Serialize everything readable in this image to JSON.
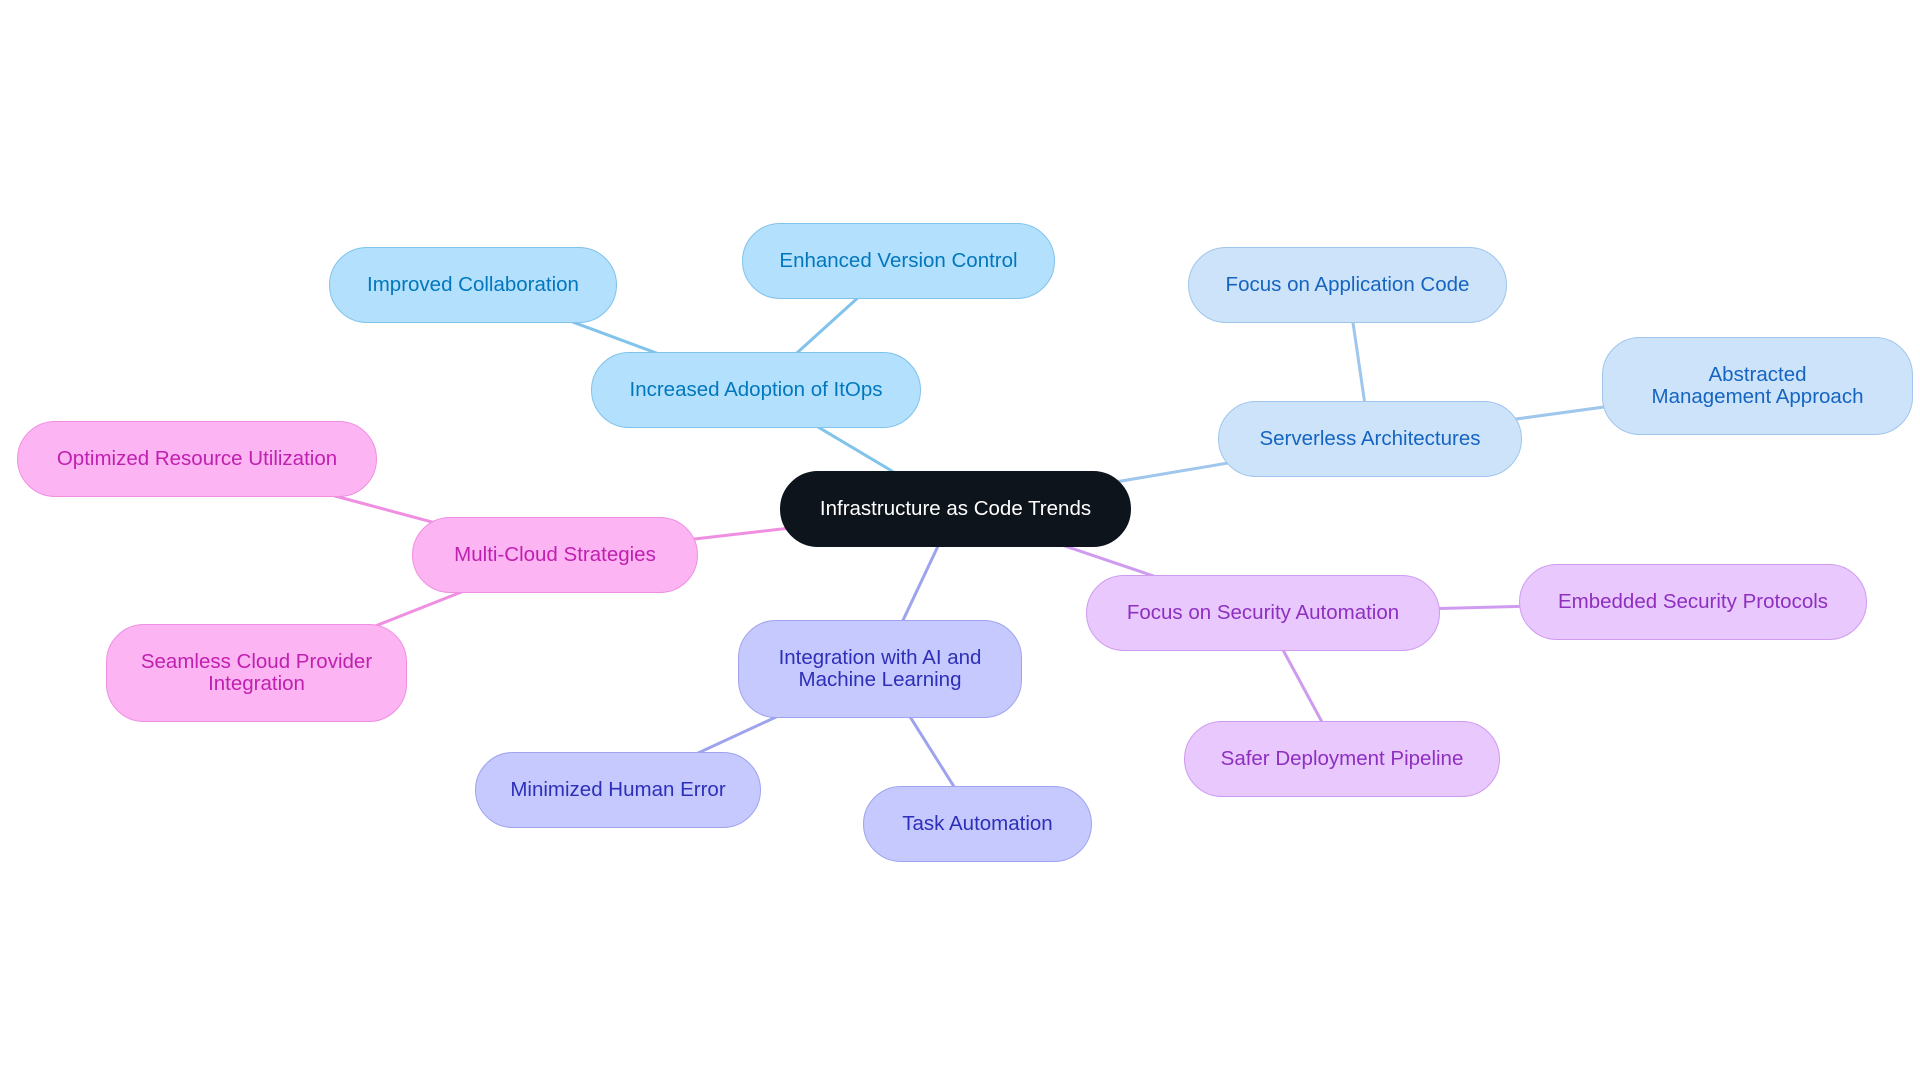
{
  "diagram": {
    "type": "mindmap",
    "root": {
      "id": "root",
      "label": "Infrastructure as Code Trends"
    },
    "branches": [
      {
        "id": "adopt",
        "label": "Increased Adoption of ItOps",
        "color": "#81c3ea",
        "children": [
          {
            "id": "collab",
            "label": "Improved Collaboration"
          },
          {
            "id": "version",
            "label": "Enhanced Version Control"
          }
        ]
      },
      {
        "id": "server",
        "label": "Serverless Architectures",
        "color": "#9fc6ec",
        "children": [
          {
            "id": "appcode",
            "label": "Focus on Application Code"
          },
          {
            "id": "abstract",
            "label": "Abstracted Management Approach"
          }
        ]
      },
      {
        "id": "sec",
        "label": "Focus on Security Automation",
        "color": "#cf9bf0",
        "children": [
          {
            "id": "embedded",
            "label": "Embedded Security Protocols"
          },
          {
            "id": "safer",
            "label": "Safer Deployment Pipeline"
          }
        ]
      },
      {
        "id": "ai",
        "label": "Integration with AI and Machine Learning",
        "color": "#9ea3ee",
        "children": [
          {
            "id": "human",
            "label": "Minimized Human Error"
          },
          {
            "id": "task",
            "label": "Task Automation"
          }
        ]
      },
      {
        "id": "multi",
        "label": "Multi-Cloud Strategies",
        "color": "#f08fe2",
        "children": [
          {
            "id": "optim",
            "label": "Optimized Resource Utilization"
          },
          {
            "id": "seamless",
            "label": "Seamless Cloud Provider Integration"
          }
        ]
      }
    ]
  }
}
